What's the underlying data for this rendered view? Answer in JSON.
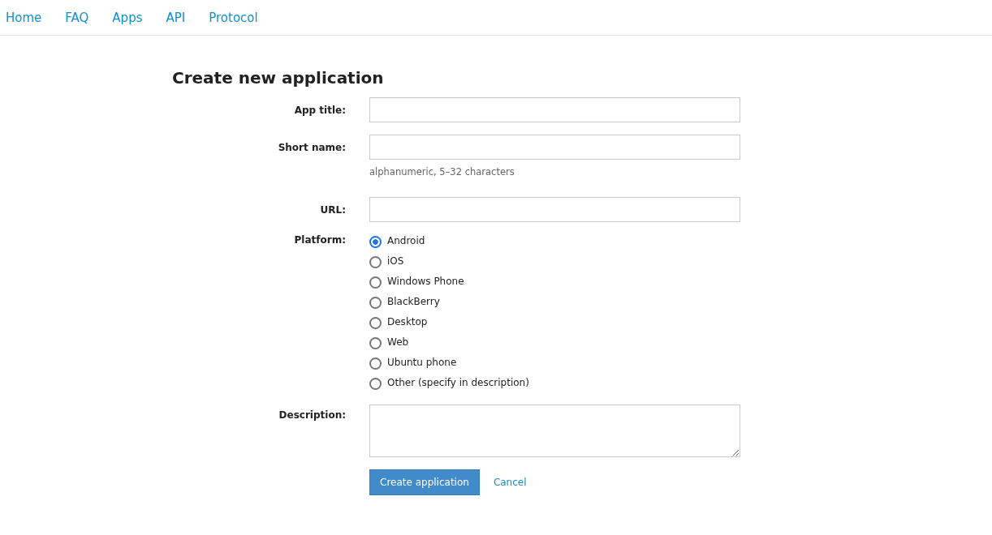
{
  "nav": [
    {
      "label": "Home"
    },
    {
      "label": "FAQ"
    },
    {
      "label": "Apps"
    },
    {
      "label": "API"
    },
    {
      "label": "Protocol"
    }
  ],
  "heading": "Create new application",
  "fields": [
    {
      "kind": "text",
      "label": "App title:"
    },
    {
      "kind": "text",
      "label": "Short name:",
      "hint": "alphanumeric, 5–32 characters"
    },
    {
      "kind": "text",
      "label": "URL:"
    },
    {
      "kind": "radio",
      "label": "Platform:",
      "options": [
        {
          "label": "Android",
          "selected": true
        },
        {
          "label": "iOS",
          "selected": false
        },
        {
          "label": "Windows Phone",
          "selected": false
        },
        {
          "label": "BlackBerry",
          "selected": false
        },
        {
          "label": "Desktop",
          "selected": false
        },
        {
          "label": "Web",
          "selected": false
        },
        {
          "label": "Ubuntu phone",
          "selected": false
        },
        {
          "label": "Other (specify in description)",
          "selected": false
        }
      ]
    },
    {
      "kind": "textarea",
      "label": "Description:"
    }
  ],
  "submit": "Create application",
  "cancel": "Cancel"
}
